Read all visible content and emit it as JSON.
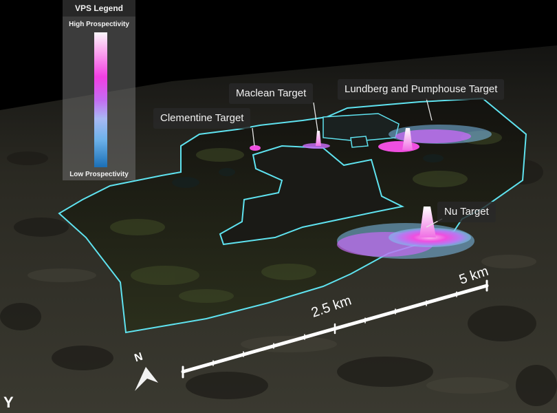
{
  "legend": {
    "title": "VPS Legend",
    "high_label": "High Prospectivity",
    "low_label": "Low Prospectivity",
    "colors": [
      "#fbf7fb",
      "#fba8ef",
      "#f23ee3",
      "#c46bf2",
      "#a8b9f4",
      "#6bb1e9",
      "#1b6fb6"
    ]
  },
  "targets": {
    "clementine": "Clementine Target",
    "maclean": "Maclean Target",
    "lundberg": "Lundberg and Pumphouse Target",
    "nu": "Nu Target"
  },
  "scale_bar": {
    "mid_label": "2.5 km",
    "end_label": "5 km"
  },
  "north_arrow": {
    "label": "N",
    "icon": "north-arrow-icon"
  },
  "axis_indicator": {
    "label": "Y"
  },
  "colors": {
    "boundary": "#5fe3f0",
    "sky": "#000000",
    "terrain": "#2e2d25"
  }
}
